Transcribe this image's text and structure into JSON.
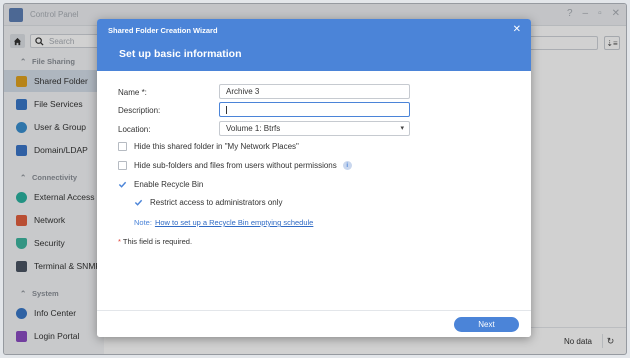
{
  "window": {
    "title": "Control Panel",
    "controls": [
      "?",
      "–",
      "▫",
      "✕"
    ]
  },
  "sidebar": {
    "search_placeholder": "Search",
    "sections": [
      {
        "label": "File Sharing"
      },
      {
        "label": "Connectivity"
      },
      {
        "label": "System"
      }
    ],
    "items": [
      {
        "label": "Shared Folder",
        "color": "#e0a21f"
      },
      {
        "label": "File Services",
        "color": "#3a78c9"
      },
      {
        "label": "User & Group",
        "color": "#3a8fd0"
      },
      {
        "label": "Domain/LDAP",
        "color": "#3b76c8"
      },
      {
        "label": "External Access",
        "color": "#2bb3a0"
      },
      {
        "label": "Network",
        "color": "#e2603f"
      },
      {
        "label": "Security",
        "color": "#3fb6a0"
      },
      {
        "label": "Terminal & SNMP",
        "color": "#4b5563"
      },
      {
        "label": "Info Center",
        "color": "#3a78c9"
      },
      {
        "label": "Login Portal",
        "color": "#8b4cc2"
      }
    ]
  },
  "main": {
    "no_data": "No data"
  },
  "wizard": {
    "title": "Shared Folder Creation Wizard",
    "step_title": "Set up basic information",
    "name_label": "Name *:",
    "name_value": "Archive 3",
    "description_label": "Description:",
    "description_value": "",
    "location_label": "Location:",
    "location_value": "Volume 1:  Btrfs",
    "checkboxes": [
      {
        "label": "Hide this shared folder in \"My Network Places\"",
        "checked": false
      },
      {
        "label": "Hide sub-folders and files from users without permissions",
        "checked": false
      },
      {
        "label": "Enable Recycle Bin",
        "checked": true
      },
      {
        "label": "Restrict access to administrators only",
        "checked": true
      }
    ],
    "note_label": "Note:",
    "note_link": "How to set up a Recycle Bin emptying schedule",
    "required_star": "*",
    "required_text": " This field is required.",
    "next_button": "Next"
  },
  "colors": {
    "accent": "#4b84d8",
    "required": "#e03c31"
  }
}
